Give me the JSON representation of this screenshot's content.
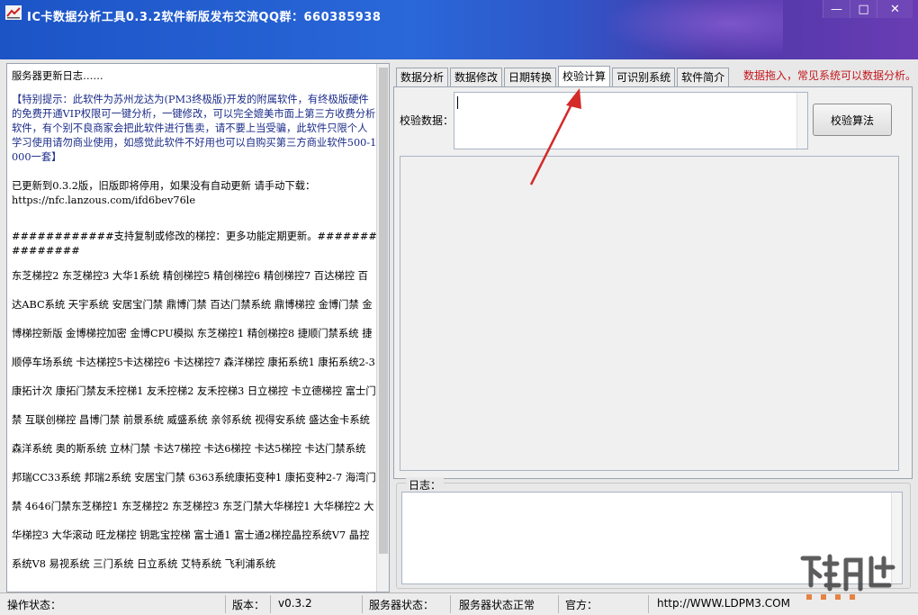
{
  "window": {
    "title": "IC卡数据分析工具0.3.2软件新版发布交流QQ群：660385938",
    "minimize_glyph": "—",
    "maximize_glyph": "□",
    "close_glyph": "✕"
  },
  "log_panel": {
    "heading": "服务器更新日志……",
    "notice": "【特别提示：此软件为苏州龙达为(PM3终极版)开发的附属软件，有终极版硬件的免费开通VIP权限可一键分析，一键修改，可以完全媲美市面上第三方收费分析软件，有个别不良商家会把此软件进行售卖，请不要上当受骗，此软件只限个人学习使用请勿商业使用，如感觉此软件不好用也可以自购买第三方商业软件500-1000一套】",
    "update_line": "已更新到0.3.2版，旧版即将停用，如果没有自动更新 请手动下载：",
    "download_url": "https://nfc.lanzous.com/ifd6bev76le",
    "support_header": "############支持复制或修改的梯控：更多功能定期更新。###############",
    "systems": "东芝梯控2 东芝梯控3 大华1系统 精创梯控5 精创梯控6 精创梯控7 百达梯控 百达ABC系统 天宇系统 安居宝门禁 鼎博门禁 百达门禁系统 鼎博梯控 金博门禁 金博梯控新版 金博梯控加密 金博CPU模拟 东芝梯控1 精创梯控8 捷顺门禁系统 捷顺停车场系统 卡达梯控5卡达梯控6 卡达梯控7 森洋梯控 康拓系统1 康拓系统2-3 康拓计次 康拓门禁友禾控梯1 友禾控梯2 友禾控梯3 日立梯控 卡立德梯控  富士门禁 互联创梯控 昌博门禁 前景系统 威盛系统 亲邻系统 视得安系统  盛达金卡系统 森洋系统 奥的斯系统 立林门禁 卡达7梯控 卡达6梯控 卡达5梯控 卡达门禁系统 邦瑞CC33系统 邦瑞2系统 安居宝门禁 6363系统康拓变种1 康拓变种2-7 海湾门禁 4646门禁东芝梯控1 东芝梯控2 东芝梯控3 东芝门禁大华梯控1  大华梯控2 大华梯控3 大华滚动  旺龙梯控  钥匙宝控梯 富士通1 富士通2梯控晶控系统V7 晶控系统V8 易视系统 三门系统 日立系统 艾特系统 飞利浦系统"
  },
  "tabs": [
    "数据分析",
    "数据修改",
    "日期转换",
    "校验计算",
    "可识别系统",
    "软件简介"
  ],
  "active_tab": "校验计算",
  "drag_notice": "数据拖入，常见系统可以数据分析。",
  "check_page": {
    "label": "校验数据：",
    "input_value": "",
    "button_label": "校验算法"
  },
  "log_group": {
    "label": "日志："
  },
  "status_bar": {
    "op_label": "操作状态：",
    "version_label": "版本：",
    "version_value": "v0.3.2",
    "server_label": "服务器状态：",
    "server_value": "服务器状态正常",
    "site_label": "官方：",
    "site_value": "http://WWW.LDPM3.COM"
  },
  "colors": {
    "titlebar": "#2a67d8",
    "notice_red": "#c4161c",
    "arrow_red": "#d42a2a",
    "link_blue": "#1a2b88"
  }
}
